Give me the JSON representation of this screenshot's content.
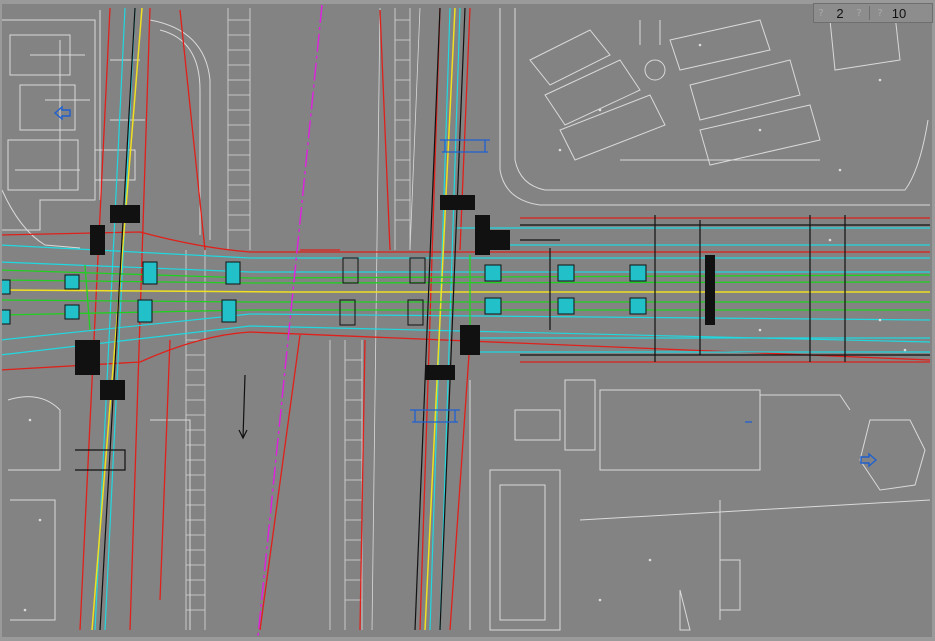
{
  "app": {
    "view": "cad-drawing-viewer"
  },
  "toolbar": {
    "page_current": "2",
    "page_total": "10",
    "prev_icon": "question-glyph-icon",
    "next_icon": "question-glyph-icon"
  },
  "colors": {
    "background": "#838383",
    "linework": "#d9d9d9",
    "road_edge": "#e0201a",
    "lane_cyan": "#20d8e0",
    "centerline_yellow": "#f0e020",
    "track_green": "#20d020",
    "magenta_axis": "#e020e0",
    "marker_blue": "#2060d0",
    "black_detail": "#111111"
  },
  "markers": [
    {
      "name": "direction-arrow-left",
      "icon": "arrow-left-icon"
    },
    {
      "name": "direction-arrow-right",
      "icon": "arrow-right-icon"
    },
    {
      "name": "north-arrow",
      "icon": "arrow-down-icon"
    }
  ]
}
